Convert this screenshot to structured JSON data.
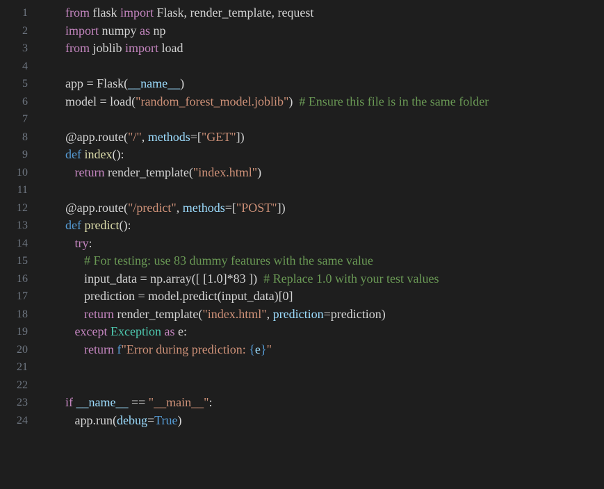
{
  "editor": {
    "lines": [
      {
        "n": "1",
        "tokens": [
          [
            "ctl",
            "from"
          ],
          [
            "plain",
            " flask "
          ],
          [
            "ctl",
            "import"
          ],
          [
            "plain",
            " Flask, render_template, request"
          ]
        ]
      },
      {
        "n": "2",
        "tokens": [
          [
            "ctl",
            "import"
          ],
          [
            "plain",
            " numpy "
          ],
          [
            "ctl",
            "as"
          ],
          [
            "plain",
            " np"
          ]
        ]
      },
      {
        "n": "3",
        "tokens": [
          [
            "ctl",
            "from"
          ],
          [
            "plain",
            " joblib "
          ],
          [
            "ctl",
            "import"
          ],
          [
            "plain",
            " load"
          ]
        ]
      },
      {
        "n": "4",
        "tokens": []
      },
      {
        "n": "5",
        "tokens": [
          [
            "plain",
            "app = Flask("
          ],
          [
            "var",
            "__name__"
          ],
          [
            "plain",
            ")"
          ]
        ]
      },
      {
        "n": "6",
        "tokens": [
          [
            "plain",
            "model = load("
          ],
          [
            "str",
            "\"random_forest_model.joblib\""
          ],
          [
            "plain",
            ")  "
          ],
          [
            "cmt",
            "# Ensure this file is in the same folder"
          ]
        ]
      },
      {
        "n": "7",
        "tokens": []
      },
      {
        "n": "8",
        "tokens": [
          [
            "plain",
            "@app.route("
          ],
          [
            "str",
            "\"/\""
          ],
          [
            "plain",
            ", "
          ],
          [
            "var",
            "methods"
          ],
          [
            "plain",
            "=["
          ],
          [
            "str",
            "\"GET\""
          ],
          [
            "plain",
            "])"
          ]
        ]
      },
      {
        "n": "9",
        "tokens": [
          [
            "kw",
            "def"
          ],
          [
            "plain",
            " "
          ],
          [
            "fn",
            "index"
          ],
          [
            "plain",
            "():"
          ]
        ]
      },
      {
        "n": "10",
        "tokens": [
          [
            "plain",
            "   "
          ],
          [
            "ctl",
            "return"
          ],
          [
            "plain",
            " render_template("
          ],
          [
            "str",
            "\"index.html\""
          ],
          [
            "plain",
            ")"
          ]
        ]
      },
      {
        "n": "11",
        "tokens": []
      },
      {
        "n": "12",
        "tokens": [
          [
            "plain",
            "@app.route("
          ],
          [
            "str",
            "\"/predict\""
          ],
          [
            "plain",
            ", "
          ],
          [
            "var",
            "methods"
          ],
          [
            "plain",
            "=["
          ],
          [
            "str",
            "\"POST\""
          ],
          [
            "plain",
            "])"
          ]
        ]
      },
      {
        "n": "13",
        "tokens": [
          [
            "kw",
            "def"
          ],
          [
            "plain",
            " "
          ],
          [
            "fn",
            "predict"
          ],
          [
            "plain",
            "():"
          ]
        ]
      },
      {
        "n": "14",
        "tokens": [
          [
            "plain",
            "   "
          ],
          [
            "ctl",
            "try"
          ],
          [
            "plain",
            ":"
          ]
        ]
      },
      {
        "n": "15",
        "tokens": [
          [
            "plain",
            "      "
          ],
          [
            "cmt",
            "# For testing: use 83 dummy features with the same value"
          ]
        ]
      },
      {
        "n": "16",
        "tokens": [
          [
            "plain",
            "      input_data = np.array([ [1.0]*83 ])  "
          ],
          [
            "cmt",
            "# Replace 1.0 with your test values"
          ]
        ]
      },
      {
        "n": "17",
        "tokens": [
          [
            "plain",
            "      prediction = model.predict(input_data)[0]"
          ]
        ]
      },
      {
        "n": "18",
        "tokens": [
          [
            "plain",
            "      "
          ],
          [
            "ctl",
            "return"
          ],
          [
            "plain",
            " render_template("
          ],
          [
            "str",
            "\"index.html\""
          ],
          [
            "plain",
            ", "
          ],
          [
            "var",
            "prediction"
          ],
          [
            "plain",
            "=prediction)"
          ]
        ]
      },
      {
        "n": "19",
        "tokens": [
          [
            "plain",
            "   "
          ],
          [
            "ctl",
            "except"
          ],
          [
            "plain",
            " "
          ],
          [
            "cls",
            "Exception"
          ],
          [
            "plain",
            " "
          ],
          [
            "ctl",
            "as"
          ],
          [
            "plain",
            " e:"
          ]
        ]
      },
      {
        "n": "20",
        "tokens": [
          [
            "plain",
            "      "
          ],
          [
            "ctl",
            "return"
          ],
          [
            "plain",
            " "
          ],
          [
            "kw",
            "f"
          ],
          [
            "str",
            "\"Error during prediction: "
          ],
          [
            "kw",
            "{"
          ],
          [
            "var",
            "e"
          ],
          [
            "kw",
            "}"
          ],
          [
            "str",
            "\""
          ]
        ]
      },
      {
        "n": "21",
        "tokens": []
      },
      {
        "n": "22",
        "tokens": []
      },
      {
        "n": "23",
        "tokens": [
          [
            "ctl",
            "if"
          ],
          [
            "plain",
            " "
          ],
          [
            "var",
            "__name__"
          ],
          [
            "plain",
            " == "
          ],
          [
            "str",
            "\"__main__\""
          ],
          [
            "plain",
            ":"
          ]
        ]
      },
      {
        "n": "24",
        "tokens": [
          [
            "plain",
            "   app.run("
          ],
          [
            "var",
            "debug"
          ],
          [
            "plain",
            "="
          ],
          [
            "kw",
            "True"
          ],
          [
            "plain",
            ")"
          ]
        ]
      }
    ]
  }
}
